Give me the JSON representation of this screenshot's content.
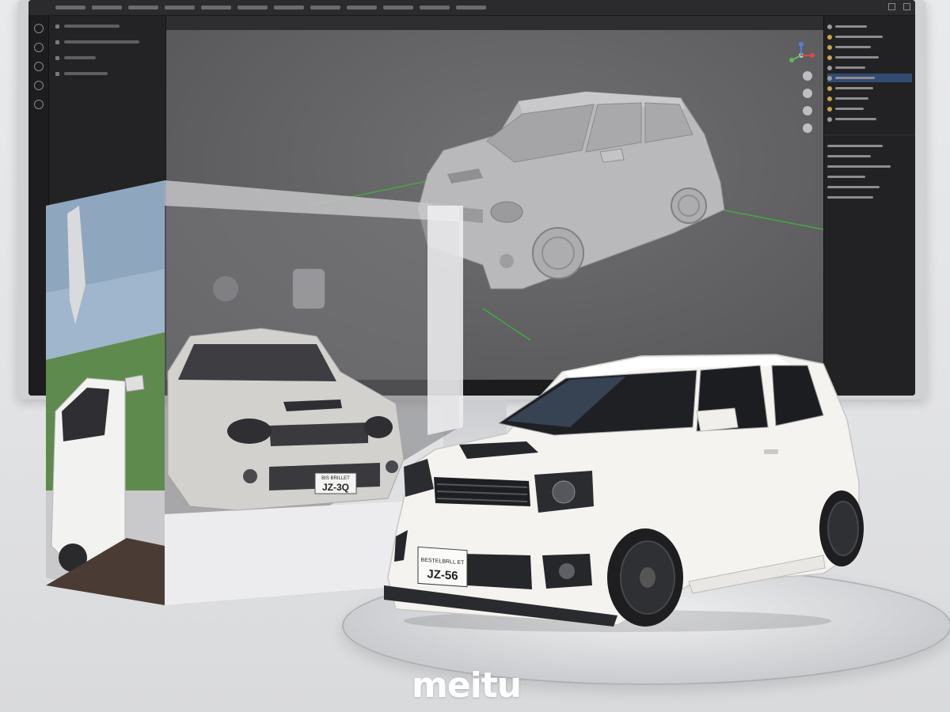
{
  "scene": {
    "description_free": true,
    "colors": {
      "background": "#e5e6e8",
      "car_body": "#f3f2ee",
      "wheel": "#2a2a2c",
      "viewport": "#666668",
      "screen_bezel": "#0b0b0c",
      "selection": "#334b73"
    }
  },
  "plates": {
    "box_car_plate": "JZ-3Q",
    "box_car_plate_top": "BIS BRILLET",
    "model_car_plate": "JZ-56",
    "model_car_plate_top": "BESTELBRLL ET"
  },
  "watermark": {
    "logo_text": "meitu"
  },
  "icons": {
    "gizmo": "axis-gizmo-icon",
    "tools": [
      "cursor-icon",
      "move-icon",
      "rotate-icon",
      "scale-icon",
      "transform-icon"
    ]
  }
}
